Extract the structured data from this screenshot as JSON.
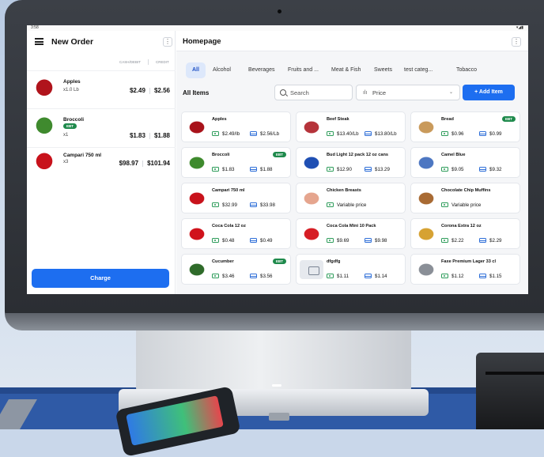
{
  "status_bar": {
    "time": "3:58",
    "icons": "▾◢▮"
  },
  "order": {
    "title": "New Order",
    "menu_icon": "hamburger-icon",
    "more_icon": "more-vertical-icon",
    "more_glyph": "⋮",
    "col_cash": "CASH/DEBIT",
    "col_credit": "CREDIT",
    "items": [
      {
        "name": "Apples",
        "qty": "x1.0 Lb",
        "ebt": "",
        "cash": "$2.49",
        "credit": "$2.56",
        "color": "#b0141c"
      },
      {
        "name": "Broccoli",
        "qty": "x1",
        "ebt": "EBT",
        "cash": "$1.83",
        "credit": "$1.88",
        "color": "#3f8a2e"
      },
      {
        "name": "Campari 750 ml",
        "qty": "x3",
        "ebt": "",
        "cash": "$98.97",
        "credit": "$101.94",
        "color": "#c8121b"
      }
    ],
    "charge_label": "Charge"
  },
  "homepage": {
    "title": "Homepage",
    "more_glyph": "⋮",
    "categories": [
      "All",
      "Alcohol",
      "Beverages",
      "Fruits and ...",
      "Meat & Fish",
      "Sweets",
      "test categ...",
      "Tobacco"
    ],
    "active_category": "All",
    "section_title": "All Items",
    "search_placeholder": "Search",
    "sort_label": "Price",
    "sort_icon": "sort-bars-icon",
    "sort_glyph": "ılı",
    "sort_chevron": "⌄",
    "add_label": "+ Add Item",
    "products": [
      {
        "name": "Apples",
        "ebt": "",
        "cash": "$2.49/lb",
        "credit": "$2.56/Lb",
        "color": "#a8121a"
      },
      {
        "name": "Beef Steak",
        "ebt": "",
        "cash": "$13.40/Lb",
        "credit": "$13.80/Lb",
        "color": "#b5333a"
      },
      {
        "name": "Bread",
        "ebt": "EBT",
        "cash": "$0.96",
        "credit": "$0.99",
        "color": "#c99a5b"
      },
      {
        "name": "Broccoli",
        "ebt": "EBT",
        "cash": "$1.83",
        "credit": "$1.88",
        "color": "#3e8a2d"
      },
      {
        "name": "Bud Light 12 pack 12 oz cans",
        "ebt": "",
        "cash": "$12.90",
        "credit": "$13.29",
        "color": "#1f4fb3"
      },
      {
        "name": "Camel Blue",
        "ebt": "",
        "cash": "$9.05",
        "credit": "$9.32",
        "color": "#4d77c2"
      },
      {
        "name": "Campari 750 ml",
        "ebt": "",
        "cash": "$32.99",
        "credit": "$33.98",
        "color": "#c8121b"
      },
      {
        "name": "Chicken Breasts",
        "ebt": "",
        "cash": "Variable price",
        "credit": "",
        "color": "#e5a58e"
      },
      {
        "name": "Chocolate Chip Muffins",
        "ebt": "",
        "cash": "Variable price",
        "credit": "",
        "color": "#a86a33"
      },
      {
        "name": "Coca Cola 12 oz",
        "ebt": "",
        "cash": "$0.48",
        "credit": "$0.49",
        "color": "#d0121b"
      },
      {
        "name": "Coca Cola Mini 10 Pack",
        "ebt": "",
        "cash": "$9.69",
        "credit": "$9.98",
        "color": "#d61d24"
      },
      {
        "name": "Corona Extra 12 oz",
        "ebt": "",
        "cash": "$2.22",
        "credit": "$2.29",
        "color": "#d6a233"
      },
      {
        "name": "Cucumber",
        "ebt": "EBT",
        "cash": "$3.46",
        "credit": "$3.56",
        "color": "#2f6b2a"
      },
      {
        "name": "dfgdfg",
        "ebt": "",
        "cash": "$1.11",
        "credit": "$1.14",
        "color": "#e6e9ee"
      },
      {
        "name": "Faxe Premium Lager 33 cl",
        "ebt": "",
        "cash": "$1.12",
        "credit": "$1.15",
        "color": "#8a8f97"
      }
    ]
  }
}
